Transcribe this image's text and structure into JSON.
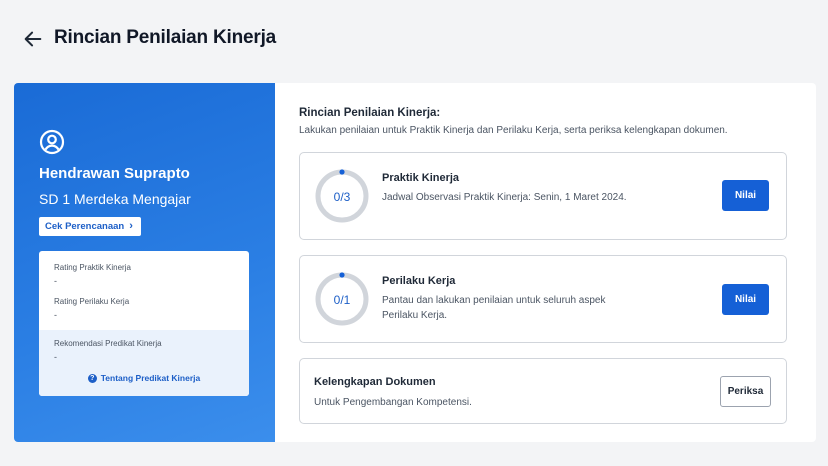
{
  "header": {
    "title": "Rincian Penilaian Kinerja"
  },
  "profile": {
    "name": "Hendrawan Suprapto",
    "school": "SD 1 Merdeka Mengajar",
    "plan_button": "Cek Perencanaan",
    "ratings": [
      {
        "label": "Rating Praktik Kinerja",
        "value": "-"
      },
      {
        "label": "Rating Perilaku Kerja",
        "value": "-"
      }
    ],
    "recommendation": {
      "label": "Rekomendasi Predikat Kinerja",
      "value": "-"
    },
    "about_link": "Tentang Predikat Kinerja"
  },
  "content": {
    "title": "Rincian Penilaian Kinerja:",
    "subtitle": "Lakukan penilaian untuk Praktik Kinerja dan Perilaku Kerja, serta periksa kelengkapan dokumen.",
    "items": [
      {
        "title": "Praktik Kinerja",
        "desc": "Jadwal Observasi Praktik Kinerja: Senin, 1 Maret 2024.",
        "progress": "0/3",
        "action": "Nilai"
      },
      {
        "title": "Perilaku Kerja",
        "desc": "Pantau dan lakukan penilaian untuk seluruh aspek Perilaku Kerja.",
        "progress": "0/1",
        "action": "Nilai"
      }
    ],
    "documents": {
      "title": "Kelengkapan Dokumen",
      "desc": "Untuk Pengembangan Kompetensi.",
      "action": "Periksa"
    }
  },
  "colors": {
    "primary": "#1560d6",
    "panel": "#2b7fe4",
    "ring_track": "#d1d5db"
  }
}
